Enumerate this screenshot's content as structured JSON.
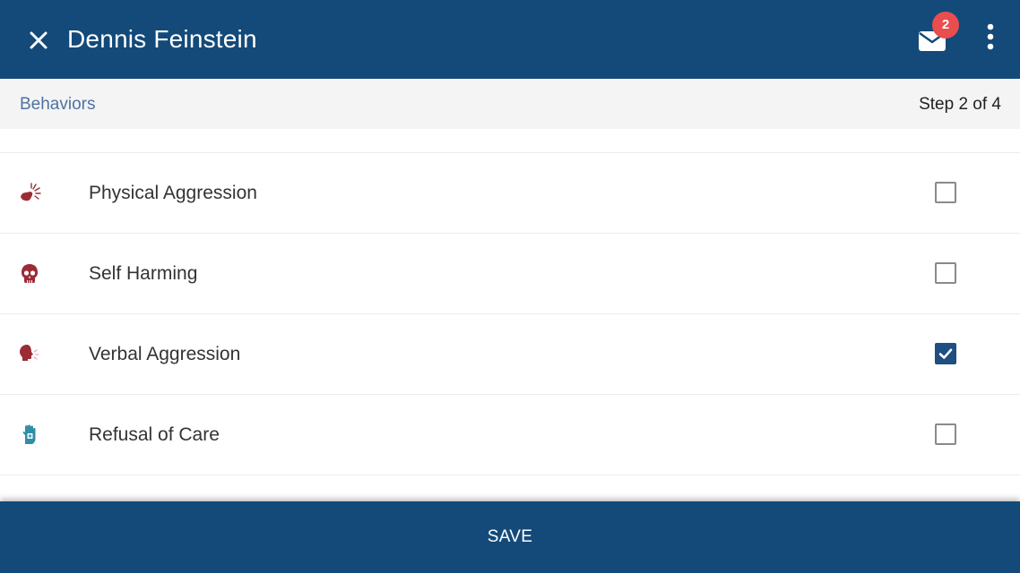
{
  "header": {
    "title": "Dennis Feinstein",
    "close_icon": "close-icon",
    "mail_icon": "mail-icon",
    "mail_badge_count": "2",
    "more_icon": "more-vertical-icon",
    "background_color": "#134a79",
    "badge_color": "#ea4d4d"
  },
  "subheader": {
    "section": "Behaviors",
    "step": "Step 2 of 4"
  },
  "behaviors": [
    {
      "label": "Physical Aggression",
      "icon": "physical-aggression-icon",
      "checked": false
    },
    {
      "label": "Self Harming",
      "icon": "skull-icon",
      "checked": false
    },
    {
      "label": "Verbal Aggression",
      "icon": "shouting-head-icon",
      "checked": true
    },
    {
      "label": "Refusal of Care",
      "icon": "hand-stop-icon",
      "checked": false
    }
  ],
  "footer": {
    "save_label": "SAVE"
  }
}
